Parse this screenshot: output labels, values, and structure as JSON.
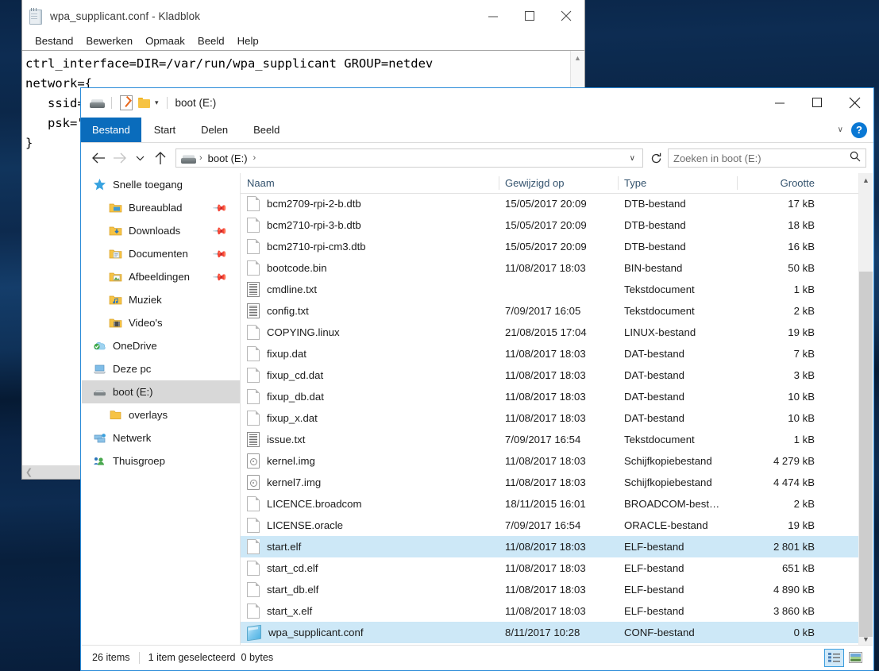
{
  "desktop": {
    "background_color": "#0b2747"
  },
  "notepad": {
    "title": "wpa_supplicant.conf - Kladblok",
    "icon": "notepad-icon",
    "menus": [
      "Bestand",
      "Bewerken",
      "Opmaak",
      "Beeld",
      "Help"
    ],
    "window_buttons": {
      "minimize": "—",
      "maximize": "☐",
      "close": "✕"
    },
    "content": "ctrl_interface=DIR=/var/run/wpa_supplicant GROUP=netdev\nnetwork={\n   ssid=\"\n   psk=\"\n}"
  },
  "explorer": {
    "title": "boot (E:)",
    "quick_access_toolbar": {
      "drive_icon": "drive-icon",
      "properties_icon": "properties-icon",
      "new_folder_icon": "new-folder-icon",
      "customize_caret": "▾"
    },
    "window_buttons": {
      "minimize": "—",
      "maximize": "☐",
      "close": "✕"
    },
    "ribbon": {
      "tabs": [
        "Bestand",
        "Start",
        "Delen",
        "Beeld"
      ],
      "active_tab": "Bestand",
      "collapse_caret": "∨",
      "help_label": "?"
    },
    "navbar": {
      "back": "←",
      "forward": "→",
      "recent_caret": "∨",
      "up": "↑",
      "breadcrumb": [
        "boot (E:)"
      ],
      "breadcrumb_sep": "›",
      "address_caret": "∨",
      "refresh": "↻"
    },
    "search": {
      "placeholder": "Zoeken in boot (E:)",
      "icon": "search-icon"
    },
    "nav_pane": [
      {
        "label": "Snelle toegang",
        "icon": "star-icon",
        "indent": false,
        "pinned": false,
        "selected": false
      },
      {
        "label": "Bureaublad",
        "icon": "desktop-folder-icon",
        "indent": true,
        "pinned": true,
        "selected": false
      },
      {
        "label": "Downloads",
        "icon": "downloads-folder-icon",
        "indent": true,
        "pinned": true,
        "selected": false
      },
      {
        "label": "Documenten",
        "icon": "documents-folder-icon",
        "indent": true,
        "pinned": true,
        "selected": false
      },
      {
        "label": "Afbeeldingen",
        "icon": "pictures-folder-icon",
        "indent": true,
        "pinned": true,
        "selected": false
      },
      {
        "label": "Muziek",
        "icon": "music-folder-icon",
        "indent": true,
        "pinned": false,
        "selected": false
      },
      {
        "label": "Video's",
        "icon": "video-folder-icon",
        "indent": true,
        "pinned": false,
        "selected": false
      },
      {
        "label": "OneDrive",
        "icon": "onedrive-icon",
        "indent": false,
        "pinned": false,
        "selected": false
      },
      {
        "label": "Deze pc",
        "icon": "this-pc-icon",
        "indent": false,
        "pinned": false,
        "selected": false
      },
      {
        "label": "boot (E:)",
        "icon": "drive-icon",
        "indent": false,
        "pinned": false,
        "selected": true
      },
      {
        "label": "overlays",
        "icon": "folder-icon",
        "indent": true,
        "pinned": false,
        "selected": false
      },
      {
        "label": "Netwerk",
        "icon": "network-icon",
        "indent": false,
        "pinned": false,
        "selected": false
      },
      {
        "label": "Thuisgroep",
        "icon": "homegroup-icon",
        "indent": false,
        "pinned": false,
        "selected": false
      }
    ],
    "columns": [
      "Naam",
      "Gewijzigd op",
      "Type",
      "Grootte"
    ],
    "sort": {
      "column": "Naam",
      "direction": "ascending",
      "glyph": "⌃"
    },
    "files": [
      {
        "name": "bcm2709-rpi-2-b.dtb",
        "modified": "15/05/2017 20:09",
        "type": "DTB-bestand",
        "size": "17 kB",
        "icon": "blank",
        "selected": false
      },
      {
        "name": "bcm2710-rpi-3-b.dtb",
        "modified": "15/05/2017 20:09",
        "type": "DTB-bestand",
        "size": "18 kB",
        "icon": "blank",
        "selected": false
      },
      {
        "name": "bcm2710-rpi-cm3.dtb",
        "modified": "15/05/2017 20:09",
        "type": "DTB-bestand",
        "size": "16 kB",
        "icon": "blank",
        "selected": false
      },
      {
        "name": "bootcode.bin",
        "modified": "11/08/2017 18:03",
        "type": "BIN-bestand",
        "size": "50 kB",
        "icon": "blank",
        "selected": false
      },
      {
        "name": "cmdline.txt",
        "modified": "",
        "type": "Tekstdocument",
        "size": "1 kB",
        "icon": "txt",
        "selected": false
      },
      {
        "name": "config.txt",
        "modified": "7/09/2017 16:05",
        "type": "Tekstdocument",
        "size": "2 kB",
        "icon": "txt",
        "selected": false
      },
      {
        "name": "COPYING.linux",
        "modified": "21/08/2015 17:04",
        "type": "LINUX-bestand",
        "size": "19 kB",
        "icon": "blank",
        "selected": false
      },
      {
        "name": "fixup.dat",
        "modified": "11/08/2017 18:03",
        "type": "DAT-bestand",
        "size": "7 kB",
        "icon": "blank",
        "selected": false
      },
      {
        "name": "fixup_cd.dat",
        "modified": "11/08/2017 18:03",
        "type": "DAT-bestand",
        "size": "3 kB",
        "icon": "blank",
        "selected": false
      },
      {
        "name": "fixup_db.dat",
        "modified": "11/08/2017 18:03",
        "type": "DAT-bestand",
        "size": "10 kB",
        "icon": "blank",
        "selected": false
      },
      {
        "name": "fixup_x.dat",
        "modified": "11/08/2017 18:03",
        "type": "DAT-bestand",
        "size": "10 kB",
        "icon": "blank",
        "selected": false
      },
      {
        "name": "issue.txt",
        "modified": "7/09/2017 16:54",
        "type": "Tekstdocument",
        "size": "1 kB",
        "icon": "txt",
        "selected": false
      },
      {
        "name": "kernel.img",
        "modified": "11/08/2017 18:03",
        "type": "Schijfkopiebestand",
        "size": "4 279 kB",
        "icon": "img",
        "selected": false
      },
      {
        "name": "kernel7.img",
        "modified": "11/08/2017 18:03",
        "type": "Schijfkopiebestand",
        "size": "4 474 kB",
        "icon": "img",
        "selected": false
      },
      {
        "name": "LICENCE.broadcom",
        "modified": "18/11/2015 16:01",
        "type": "BROADCOM-best…",
        "size": "2 kB",
        "icon": "blank",
        "selected": false
      },
      {
        "name": "LICENSE.oracle",
        "modified": "7/09/2017 16:54",
        "type": "ORACLE-bestand",
        "size": "19 kB",
        "icon": "blank",
        "selected": false
      },
      {
        "name": "start.elf",
        "modified": "11/08/2017 18:03",
        "type": "ELF-bestand",
        "size": "2 801 kB",
        "icon": "blank",
        "selected": true
      },
      {
        "name": "start_cd.elf",
        "modified": "11/08/2017 18:03",
        "type": "ELF-bestand",
        "size": "651 kB",
        "icon": "blank",
        "selected": false
      },
      {
        "name": "start_db.elf",
        "modified": "11/08/2017 18:03",
        "type": "ELF-bestand",
        "size": "4 890 kB",
        "icon": "blank",
        "selected": false
      },
      {
        "name": "start_x.elf",
        "modified": "11/08/2017 18:03",
        "type": "ELF-bestand",
        "size": "3 860 kB",
        "icon": "blank",
        "selected": false
      },
      {
        "name": "wpa_supplicant.conf",
        "modified": "8/11/2017 10:28",
        "type": "CONF-bestand",
        "size": "0 kB",
        "icon": "conf",
        "selected": true
      }
    ],
    "status": {
      "item_count": "26 items",
      "selection": "1 item geselecteerd",
      "selection_size": "0 bytes"
    },
    "view_buttons": [
      {
        "name": "details-view",
        "active": true
      },
      {
        "name": "large-icons-view",
        "active": false
      }
    ]
  }
}
